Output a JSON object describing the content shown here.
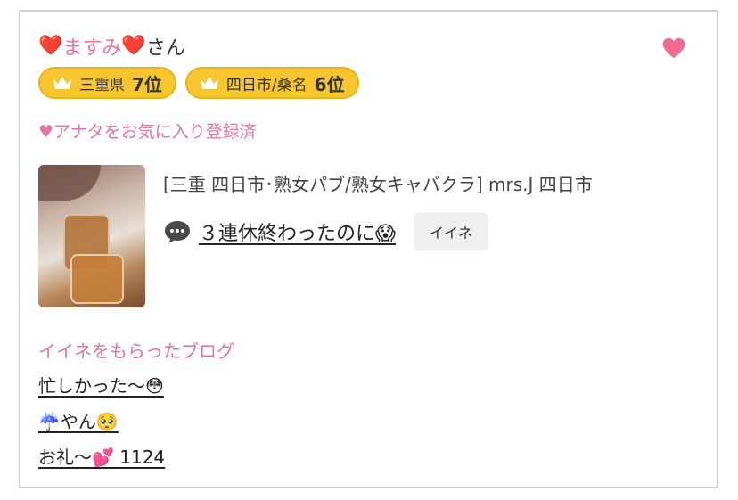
{
  "profile": {
    "heart_left": "❤️",
    "name": "ますみ",
    "heart_right": "❤️",
    "suffix": "さん",
    "favorite_icon": "heart-icon",
    "favorite_color": "#f06b91"
  },
  "ranks": [
    {
      "area": "三重県",
      "rank": "7位"
    },
    {
      "area": "四日市/桑名",
      "rank": "6位"
    }
  ],
  "favorite_status": "♥アナタをお気に入り登録済",
  "latest_post": {
    "shop": "[三重 四日市･熟女パブ/熟女キャバクラ]  mrs.J 四日市",
    "title": "３連休終わったのに😱",
    "iine_label": "イイネ"
  },
  "liked_blogs": {
    "heading": "イイネをもらったブログ",
    "items": [
      "忙しかった〜😳",
      "☔️やん🥺",
      "お礼〜💕 1124"
    ]
  },
  "colors": {
    "accent_pink": "#e075a6",
    "badge_yellow": "#f7c62e"
  }
}
